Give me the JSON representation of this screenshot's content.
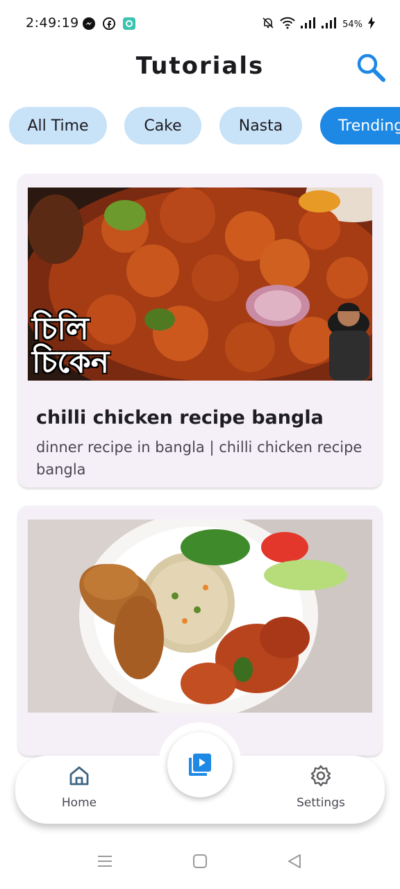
{
  "status_bar": {
    "time": "2:49:19",
    "battery": "54%",
    "left_icons": [
      "messenger-icon",
      "facebook-icon",
      "app-icon"
    ],
    "right_icons": [
      "mute-icon",
      "wifi-icon",
      "signal-icon",
      "signal-icon",
      "charging-icon"
    ]
  },
  "app_bar": {
    "title": "Tutorials",
    "search_icon": "search-icon"
  },
  "chips": [
    {
      "label": "All Time",
      "active": false
    },
    {
      "label": "Cake",
      "active": false
    },
    {
      "label": "Nasta",
      "active": false
    },
    {
      "label": "Trending",
      "active": true
    }
  ],
  "cards": [
    {
      "title": "chilli chicken recipe bangla",
      "description": "dinner recipe in bangla | chilli chicken recipe bangla",
      "overlay_text": "চিলি চিকেন"
    },
    {
      "title": "",
      "description": ""
    }
  ],
  "bottom_nav": {
    "home_label": "Home",
    "settings_label": "Settings",
    "center_icon": "video-library-icon"
  },
  "colors": {
    "accent": "#1e88e5",
    "chip_bg": "#c8e2f8",
    "card_bg": "#f5f0f8",
    "nav_icon": "#3d6584"
  }
}
